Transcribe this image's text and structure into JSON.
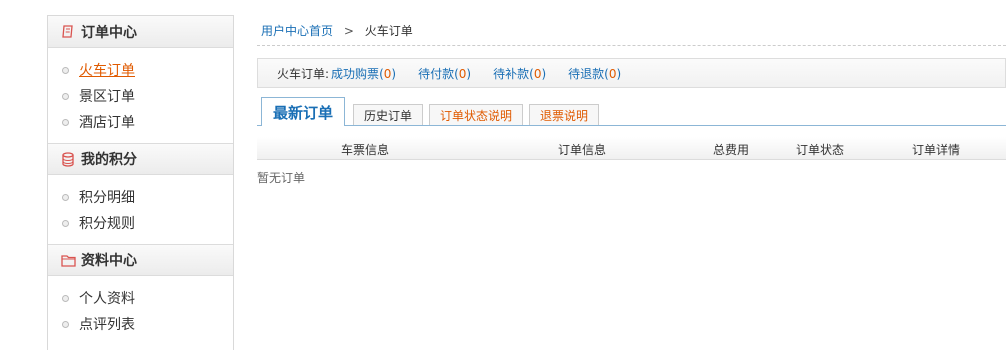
{
  "sidebar": {
    "sections": [
      {
        "title": "订单中心",
        "icon": "order-icon",
        "items": [
          {
            "label": "火车订单",
            "active": true
          },
          {
            "label": "景区订单"
          },
          {
            "label": "酒店订单"
          }
        ]
      },
      {
        "title": "我的积分",
        "icon": "coins-icon",
        "items": [
          {
            "label": "积分明细"
          },
          {
            "label": "积分规则"
          }
        ]
      },
      {
        "title": "资料中心",
        "icon": "folder-icon",
        "items": [
          {
            "label": "个人资料"
          },
          {
            "label": "点评列表"
          }
        ]
      }
    ]
  },
  "breadcrumb": {
    "home": "用户中心首页",
    "sep": ">",
    "current": "火车订单"
  },
  "filter": {
    "label": "火车订单:",
    "items": [
      {
        "label": "成功购票",
        "count": "0"
      },
      {
        "label": "待付款",
        "count": "0"
      },
      {
        "label": "待补款",
        "count": "0"
      },
      {
        "label": "待退款",
        "count": "0"
      }
    ]
  },
  "tabs": [
    {
      "label": "最新订单"
    },
    {
      "label": "历史订单"
    },
    {
      "label": "订单状态说明"
    },
    {
      "label": "退票说明"
    }
  ],
  "table": {
    "headers": [
      "车票信息",
      "订单信息",
      "总费用",
      "订单状态",
      "订单详情"
    ],
    "empty_text": "暂无订单"
  },
  "colors": {
    "link": "#1a6fb5",
    "accent": "#e05a00",
    "tab_border": "#8cb6d6"
  }
}
